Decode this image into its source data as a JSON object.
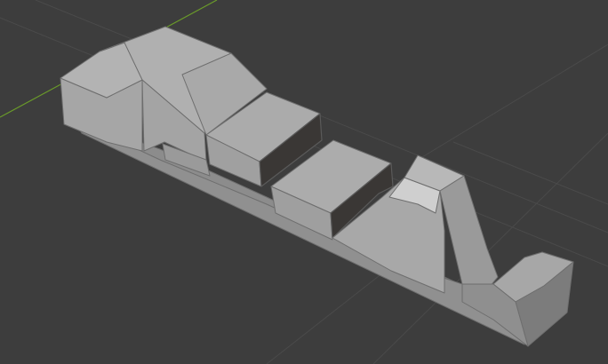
{
  "viewport": {
    "background_color": "#3d3d3d",
    "grid_color": "#4a4a4a",
    "x_axis_color": "#6a9a2a",
    "mesh_light_color": "#b4b4b4",
    "mesh_mid_color": "#9c9c9c",
    "mesh_dark_color": "#7a7a7a",
    "mesh_shadow_color": "#3a3735"
  }
}
